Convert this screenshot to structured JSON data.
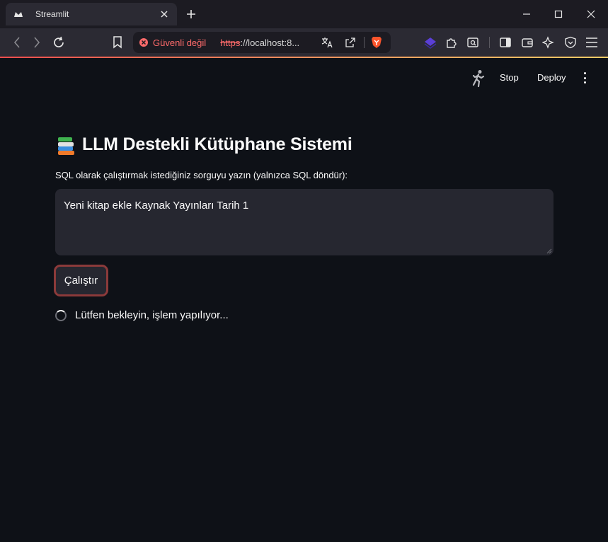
{
  "browser": {
    "tab_title": "Streamlit",
    "security_warning": "Güvenli değil",
    "url_protocol": "https",
    "url_rest": "://localhost:8...",
    "accent_gradient": [
      "#ff4d4d",
      "#ff8a5c",
      "#ffcc66"
    ]
  },
  "header": {
    "stop_label": "Stop",
    "deploy_label": "Deploy"
  },
  "main": {
    "title": "LLM Destekli Kütüphane Sistemi",
    "title_icon": "books-icon",
    "prompt_label": "SQL olarak çalıştırmak istediğiniz sorguyu yazın (yalnızca SQL döndür):",
    "query_value": "Yeni kitap ekle Kaynak Yayınları Tarih 1",
    "run_button_label": "Çalıştır",
    "status_text": "Lütfen bekleyin, işlem yapılıyor..."
  },
  "colors": {
    "app_background": "#0e1117",
    "input_background": "#262730",
    "button_focus_border": "#8b3a3a",
    "warning_red": "#ff6b6b"
  }
}
